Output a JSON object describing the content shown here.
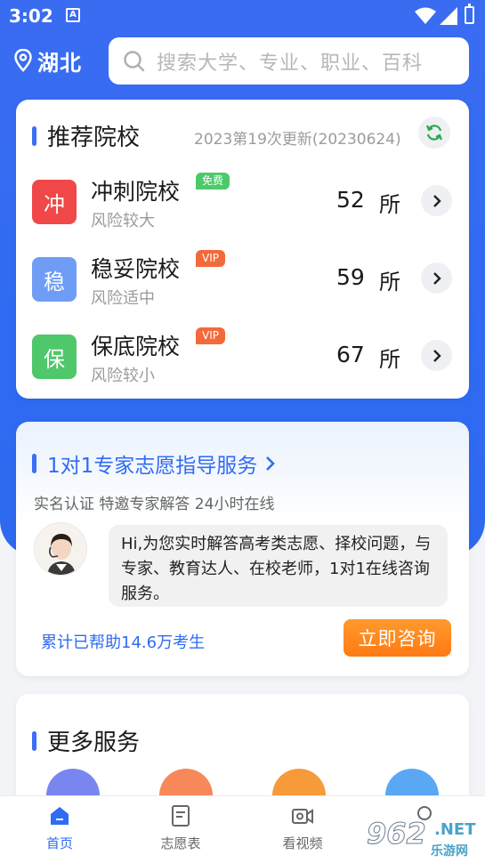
{
  "status_bar": {
    "time": "3:02",
    "app_badge": "A"
  },
  "header": {
    "location": "湖北",
    "search_placeholder": "搜索大学、专业、职业、百科"
  },
  "recommend": {
    "title": "推荐院校",
    "update_text": "2023第19次更新(20230624)",
    "rows": [
      {
        "badge": "冲",
        "badge_color": "#f04848",
        "name": "冲刺院校",
        "tag": "免费",
        "tag_color": "#4cca6a",
        "sub": "风险较大",
        "count": "52",
        "unit": "所"
      },
      {
        "badge": "稳",
        "badge_color": "#6f9cf5",
        "name": "稳妥院校",
        "tag": "VIP",
        "tag_color": "#f36a3a",
        "sub": "风险适中",
        "count": "59",
        "unit": "所"
      },
      {
        "badge": "保",
        "badge_color": "#4fc76b",
        "name": "保底院校",
        "tag": "VIP",
        "tag_color": "#f36a3a",
        "sub": "风险较小",
        "count": "67",
        "unit": "所"
      }
    ]
  },
  "expert": {
    "title": "1对1专家志愿指导服务",
    "tagline": "实名认证 特邀专家解答 24小时在线",
    "message": "Hi,为您实时解答高考类志愿、择校问题，与专家、教育达人、在校老师，1对1在线咨询服务。",
    "helped": "累计已帮助14.6万考生",
    "button": "立即咨询"
  },
  "more_services": {
    "title": "更多服务",
    "icons": [
      {
        "color": "#7a86f0"
      },
      {
        "color": "#f7885a"
      },
      {
        "color": "#f79a3a"
      },
      {
        "color": "#5aa7f4"
      }
    ]
  },
  "tabbar": {
    "tabs": [
      {
        "label": "首页",
        "active": true
      },
      {
        "label": "志愿表",
        "active": false
      },
      {
        "label": "看视频",
        "active": false
      },
      {
        "label": "",
        "active": false
      }
    ]
  },
  "watermark": {
    "big": "962",
    "small": ".NET",
    "sub": "乐游网"
  }
}
